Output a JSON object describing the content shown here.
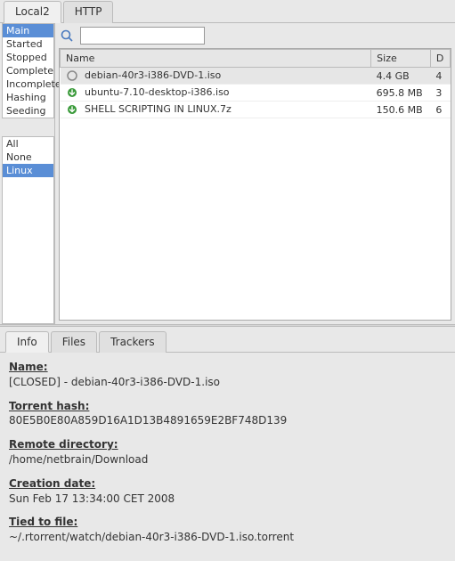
{
  "top_tabs": {
    "local": "Local2",
    "http": "HTTP"
  },
  "sidebar": {
    "states": [
      "Main",
      "Started",
      "Stopped",
      "Complete",
      "Incomplete",
      "Hashing",
      "Seeding"
    ],
    "state_selected": 0,
    "tags": [
      "All",
      "None",
      "Linux"
    ],
    "tag_selected": 2
  },
  "search": {
    "value": ""
  },
  "table": {
    "headers": {
      "name": "Name",
      "size": "Size",
      "extra": "D"
    },
    "rows": [
      {
        "icon": "closed",
        "name": "debian-40r3-i386-DVD-1.iso",
        "size": "4.4 GB",
        "extra": "4",
        "selected": true
      },
      {
        "icon": "down",
        "name": "ubuntu-7.10-desktop-i386.iso",
        "size": "695.8 MB",
        "extra": "3",
        "selected": false
      },
      {
        "icon": "down",
        "name": "SHELL SCRIPTING IN LINUX.7z",
        "size": "150.6 MB",
        "extra": "6",
        "selected": false
      }
    ]
  },
  "detail_tabs": {
    "info": "Info",
    "files": "Files",
    "trackers": "Trackers"
  },
  "info": {
    "name_label": "Name:",
    "name_value": "[CLOSED] - debian-40r3-i386-DVD-1.iso",
    "hash_label": "Torrent hash:",
    "hash_value": "80E5B0E80A859D16A1D13B4891659E2BF748D139",
    "dir_label": "Remote directory:",
    "dir_value": "/home/netbrain/Download",
    "date_label": "Creation date:",
    "date_value": "Sun Feb 17 13:34:00 CET 2008",
    "tied_label": "Tied to file:",
    "tied_value": "~/.rtorrent/watch/debian-40r3-i386-DVD-1.iso.torrent"
  }
}
